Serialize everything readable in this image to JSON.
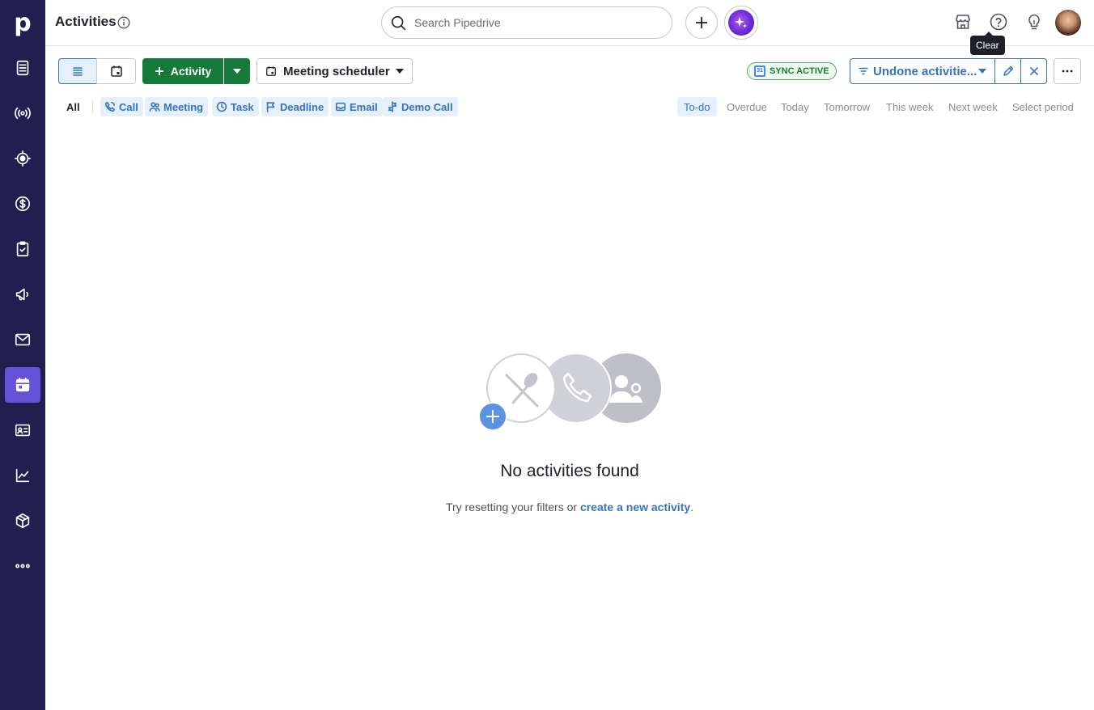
{
  "header": {
    "title": "Activities",
    "search_placeholder": "Search Pipedrive",
    "tooltip": "Clear"
  },
  "sidebar": {
    "logo": "p",
    "items": [
      {
        "icon": "leads-icon"
      },
      {
        "icon": "pulse-icon"
      },
      {
        "icon": "focus-icon"
      },
      {
        "icon": "deals-icon"
      },
      {
        "icon": "projects-icon"
      },
      {
        "icon": "campaigns-icon"
      },
      {
        "icon": "mail-icon"
      },
      {
        "icon": "activities-icon",
        "active": true
      },
      {
        "icon": "contacts-icon"
      },
      {
        "icon": "insights-icon"
      },
      {
        "icon": "products-icon"
      },
      {
        "icon": "more-icon"
      }
    ]
  },
  "toolbar": {
    "activity_label": "Activity",
    "meeting_label": "Meeting scheduler",
    "sync_label": "SYNC ACTIVE",
    "filter_label": "Undone activitie..."
  },
  "types": {
    "all": "All",
    "items": [
      "Call",
      "Meeting",
      "Task",
      "Deadline",
      "Email",
      "Demo Call"
    ]
  },
  "periods": [
    "To-do",
    "Overdue",
    "Today",
    "Tomorrow",
    "This week",
    "Next week",
    "Select period"
  ],
  "empty": {
    "title": "No activities found",
    "text_before": "Try resetting your filters or ",
    "link": "create a new activity",
    "text_after": "."
  },
  "colors": {
    "sidebar": "#221e4f",
    "active_nav": "#6552d6",
    "primary_green": "#177a3b",
    "link_blue": "#3374b9"
  }
}
